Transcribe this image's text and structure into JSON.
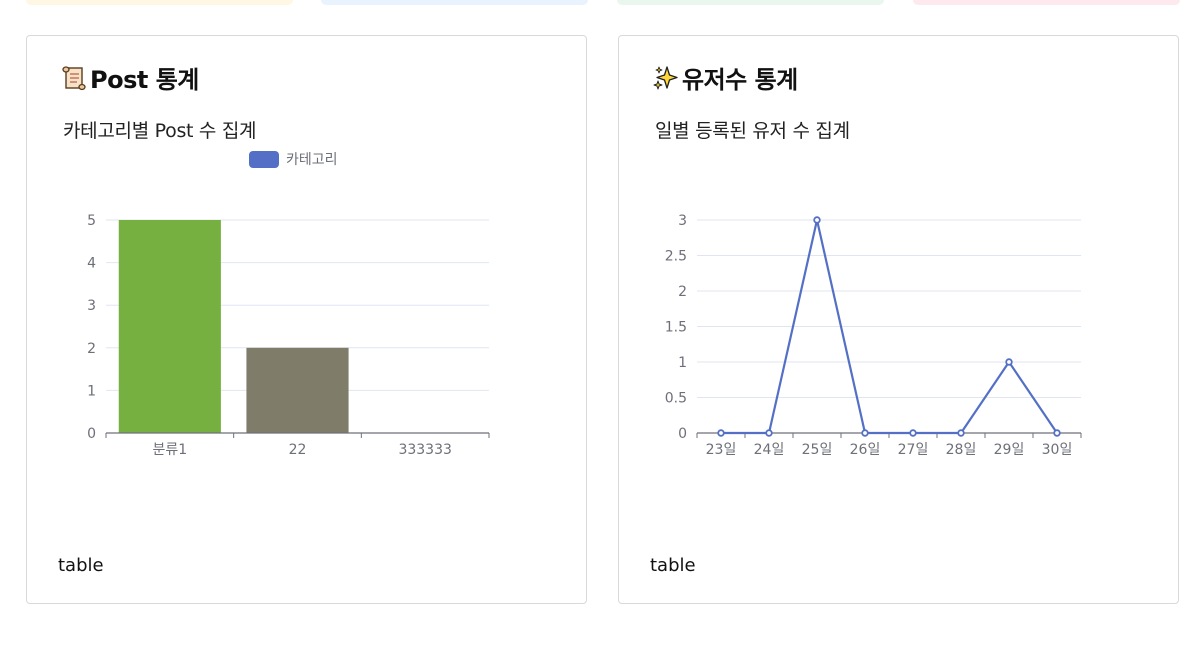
{
  "colors": {
    "strip1": "#fdf7e4",
    "strip2": "#e8f3fd",
    "strip3": "#e9f7ef",
    "strip4": "#fde9ee",
    "card_border": "#d9d9d9",
    "grid": "#e0e6f1",
    "axis": "#6e7079",
    "line": "#5470c6",
    "legend": "#5470c6"
  },
  "post_card": {
    "icon": "scroll-icon",
    "title": "Post 통계",
    "subtitle": "카테고리별 Post 수 집계",
    "footer": "table"
  },
  "user_card": {
    "icon": "sparkles-icon",
    "title": "유저수 통계",
    "subtitle": "일별 등록된 유저 수 집계",
    "footer": "table"
  },
  "chart_data": [
    {
      "type": "bar",
      "legend": [
        "카테고리"
      ],
      "legend_position": "top-center",
      "categories": [
        "분류1",
        "22",
        "333333"
      ],
      "series": [
        {
          "name": "카테고리",
          "values": [
            5,
            2,
            0
          ],
          "colors": [
            "#76b041",
            "#7f7c69",
            "#cccccc"
          ]
        }
      ],
      "ylim": [
        0,
        5
      ],
      "yticks": [
        "0",
        "1",
        "2",
        "3",
        "4",
        "5"
      ],
      "grid": true
    },
    {
      "type": "line",
      "categories": [
        "23일",
        "24일",
        "25일",
        "26일",
        "27일",
        "28일",
        "29일",
        "30일"
      ],
      "series": [
        {
          "values": [
            0,
            0,
            3,
            0,
            0,
            0,
            1,
            0
          ]
        }
      ],
      "ylim": [
        0,
        3
      ],
      "yticks": [
        "0",
        "0.5",
        "1",
        "1.5",
        "2",
        "2.5",
        "3"
      ],
      "grid": true
    }
  ]
}
